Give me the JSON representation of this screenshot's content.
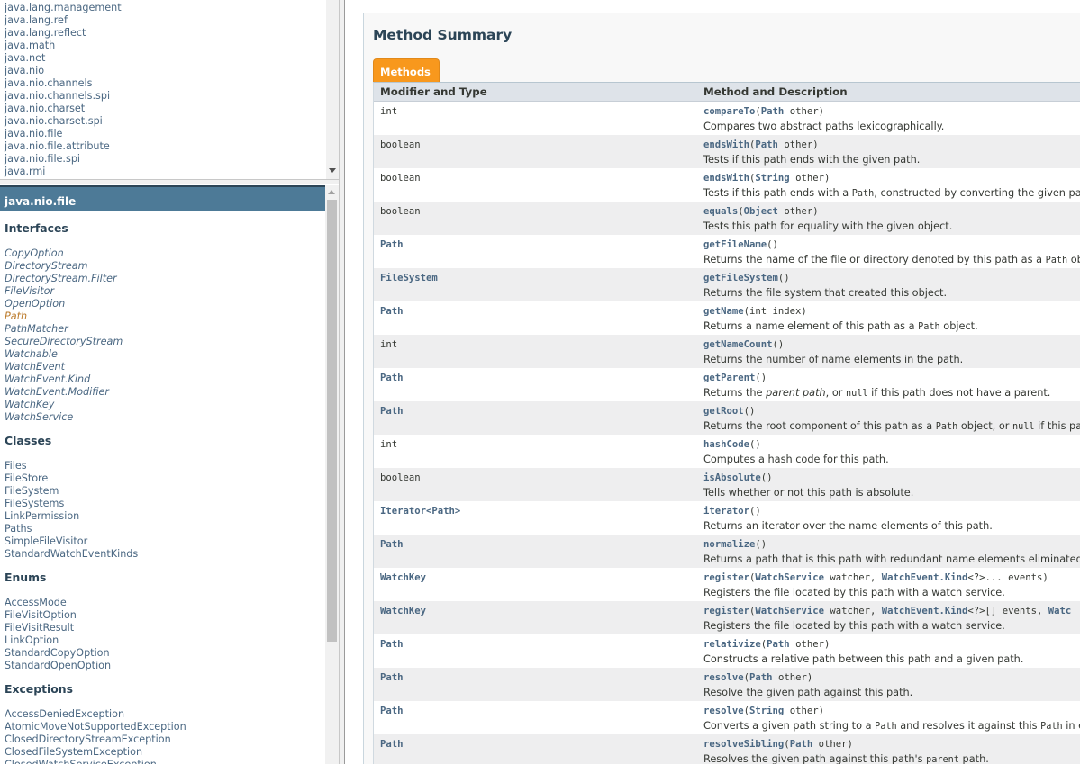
{
  "packages": [
    "java.lang.management",
    "java.lang.ref",
    "java.lang.reflect",
    "java.math",
    "java.net",
    "java.nio",
    "java.nio.channels",
    "java.nio.channels.spi",
    "java.nio.charset",
    "java.nio.charset.spi",
    "java.nio.file",
    "java.nio.file.attribute",
    "java.nio.file.spi",
    "java.rmi"
  ],
  "package_frame": {
    "title": "java.nio.file",
    "interfaces_heading": "Interfaces",
    "interfaces": [
      "CopyOption",
      "DirectoryStream",
      "DirectoryStream.Filter",
      "FileVisitor",
      "OpenOption",
      "Path",
      "PathMatcher",
      "SecureDirectoryStream",
      "Watchable",
      "WatchEvent",
      "WatchEvent.Kind",
      "WatchEvent.Modifier",
      "WatchKey",
      "WatchService"
    ],
    "active_interface": "Path",
    "classes_heading": "Classes",
    "classes": [
      "Files",
      "FileStore",
      "FileSystem",
      "FileSystems",
      "LinkPermission",
      "Paths",
      "SimpleFileVisitor",
      "StandardWatchEventKinds"
    ],
    "enums_heading": "Enums",
    "enums": [
      "AccessMode",
      "FileVisitOption",
      "FileVisitResult",
      "LinkOption",
      "StandardCopyOption",
      "StandardOpenOption"
    ],
    "exceptions_heading": "Exceptions",
    "exceptions": [
      "AccessDeniedException",
      "AtomicMoveNotSupportedException",
      "ClosedDirectoryStreamException",
      "ClosedFileSystemException",
      "ClosedWatchServiceException"
    ]
  },
  "main": {
    "summary_title": "Method Summary",
    "tab_label": "Methods",
    "col1": "Modifier and Type",
    "col2": "Method and Description",
    "methods": [
      {
        "type": "int",
        "type_link": false,
        "name": "compareTo",
        "params": [
          [
            "(",
            0
          ],
          [
            "Path",
            1
          ],
          [
            " other)",
            0
          ]
        ],
        "desc": [
          [
            "Compares two abstract paths lexicographically.",
            "t"
          ]
        ]
      },
      {
        "type": "boolean",
        "type_link": false,
        "name": "endsWith",
        "params": [
          [
            "(",
            0
          ],
          [
            "Path",
            1
          ],
          [
            " other)",
            0
          ]
        ],
        "desc": [
          [
            "Tests if this path ends with the given path.",
            "t"
          ]
        ]
      },
      {
        "type": "boolean",
        "type_link": false,
        "name": "endsWith",
        "params": [
          [
            "(",
            0
          ],
          [
            "String",
            1
          ],
          [
            " other)",
            0
          ]
        ],
        "desc": [
          [
            "Tests if this path ends with a ",
            "t"
          ],
          [
            "Path",
            "c"
          ],
          [
            ", constructed by converting the given path st",
            "t"
          ]
        ]
      },
      {
        "type": "boolean",
        "type_link": false,
        "name": "equals",
        "params": [
          [
            "(",
            0
          ],
          [
            "Object",
            1
          ],
          [
            " other)",
            0
          ]
        ],
        "desc": [
          [
            "Tests this path for equality with the given object.",
            "t"
          ]
        ]
      },
      {
        "type": "Path",
        "type_link": true,
        "name": "getFileName",
        "params": [
          [
            "()",
            0
          ]
        ],
        "desc": [
          [
            "Returns the name of the file or directory denoted by this path as a ",
            "t"
          ],
          [
            "Path",
            "c"
          ],
          [
            " object",
            "t"
          ]
        ]
      },
      {
        "type": "FileSystem",
        "type_link": true,
        "name": "getFileSystem",
        "params": [
          [
            "()",
            0
          ]
        ],
        "desc": [
          [
            "Returns the file system that created this object.",
            "t"
          ]
        ]
      },
      {
        "type": "Path",
        "type_link": true,
        "name": "getName",
        "params": [
          [
            "(int index)",
            0
          ]
        ],
        "desc": [
          [
            "Returns a name element of this path as a ",
            "t"
          ],
          [
            "Path",
            "c"
          ],
          [
            " object.",
            "t"
          ]
        ]
      },
      {
        "type": "int",
        "type_link": false,
        "name": "getNameCount",
        "params": [
          [
            "()",
            0
          ]
        ],
        "desc": [
          [
            "Returns the number of name elements in the path.",
            "t"
          ]
        ]
      },
      {
        "type": "Path",
        "type_link": true,
        "name": "getParent",
        "params": [
          [
            "()",
            0
          ]
        ],
        "desc": [
          [
            "Returns the ",
            "t"
          ],
          [
            "parent path",
            "i"
          ],
          [
            ", or ",
            "t"
          ],
          [
            "null",
            "c"
          ],
          [
            " if this path does not have a parent.",
            "t"
          ]
        ]
      },
      {
        "type": "Path",
        "type_link": true,
        "name": "getRoot",
        "params": [
          [
            "()",
            0
          ]
        ],
        "desc": [
          [
            "Returns the root component of this path as a ",
            "t"
          ],
          [
            "Path",
            "c"
          ],
          [
            " object, or ",
            "t"
          ],
          [
            "null",
            "c"
          ],
          [
            " if this path d",
            "t"
          ]
        ]
      },
      {
        "type": "int",
        "type_link": false,
        "name": "hashCode",
        "params": [
          [
            "()",
            0
          ]
        ],
        "desc": [
          [
            "Computes a hash code for this path.",
            "t"
          ]
        ]
      },
      {
        "type": "boolean",
        "type_link": false,
        "name": "isAbsolute",
        "params": [
          [
            "()",
            0
          ]
        ],
        "desc": [
          [
            "Tells whether or not this path is absolute.",
            "t"
          ]
        ]
      },
      {
        "type": "Iterator<Path>",
        "type_link": true,
        "name": "iterator",
        "params": [
          [
            "()",
            0
          ]
        ],
        "desc": [
          [
            "Returns an iterator over the name elements of this path.",
            "t"
          ]
        ]
      },
      {
        "type": "Path",
        "type_link": true,
        "name": "normalize",
        "params": [
          [
            "()",
            0
          ]
        ],
        "desc": [
          [
            "Returns a path that is this path with redundant name elements eliminated.",
            "t"
          ]
        ]
      },
      {
        "type": "WatchKey",
        "type_link": true,
        "name": "register",
        "params": [
          [
            "(",
            0
          ],
          [
            "WatchService",
            1
          ],
          [
            " watcher, ",
            0
          ],
          [
            "WatchEvent.Kind",
            1
          ],
          [
            "<?>... events)",
            0
          ]
        ],
        "desc": [
          [
            "Registers the file located by this path with a watch service.",
            "t"
          ]
        ]
      },
      {
        "type": "WatchKey",
        "type_link": true,
        "name": "register",
        "params": [
          [
            "(",
            0
          ],
          [
            "WatchService",
            1
          ],
          [
            " watcher, ",
            0
          ],
          [
            "WatchEvent.Kind",
            1
          ],
          [
            "<?>[] events, ",
            0
          ],
          [
            "Watc",
            1
          ]
        ],
        "desc": [
          [
            "Registers the file located by this path with a watch service.",
            "t"
          ]
        ]
      },
      {
        "type": "Path",
        "type_link": true,
        "name": "relativize",
        "params": [
          [
            "(",
            0
          ],
          [
            "Path",
            1
          ],
          [
            " other)",
            0
          ]
        ],
        "desc": [
          [
            "Constructs a relative path between this path and a given path.",
            "t"
          ]
        ]
      },
      {
        "type": "Path",
        "type_link": true,
        "name": "resolve",
        "params": [
          [
            "(",
            0
          ],
          [
            "Path",
            1
          ],
          [
            " other)",
            0
          ]
        ],
        "desc": [
          [
            "Resolve the given path against this path.",
            "t"
          ]
        ]
      },
      {
        "type": "Path",
        "type_link": true,
        "name": "resolve",
        "params": [
          [
            "(",
            0
          ],
          [
            "String",
            1
          ],
          [
            " other)",
            0
          ]
        ],
        "desc": [
          [
            "Converts a given path string to a ",
            "t"
          ],
          [
            "Path",
            "c"
          ],
          [
            " and resolves it against this ",
            "t"
          ],
          [
            "Path",
            "c"
          ],
          [
            " in exa",
            "t"
          ]
        ]
      },
      {
        "type": "Path",
        "type_link": true,
        "name": "resolveSibling",
        "params": [
          [
            "(",
            0
          ],
          [
            "Path",
            1
          ],
          [
            " other)",
            0
          ]
        ],
        "desc": [
          [
            "Resolves the given path against this path's ",
            "t"
          ],
          [
            "parent",
            "c"
          ],
          [
            " path.",
            "t"
          ]
        ]
      }
    ]
  }
}
